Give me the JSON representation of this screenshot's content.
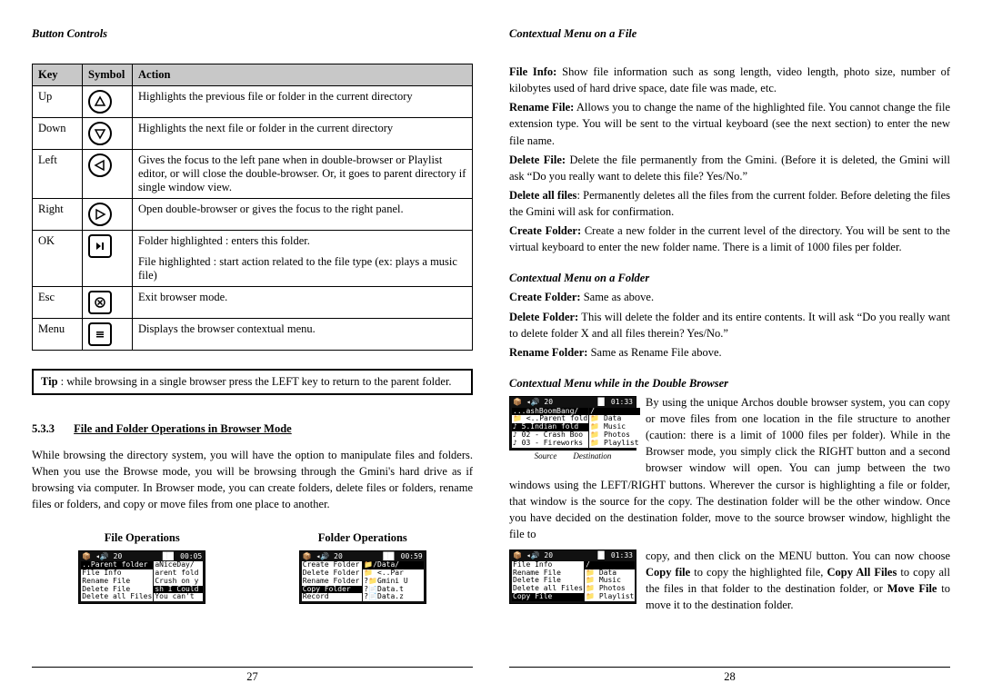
{
  "left": {
    "heading": "Button Controls",
    "table": {
      "headers": {
        "key": "Key",
        "symbol": "Symbol",
        "action": "Action"
      },
      "rows": [
        {
          "key": "Up",
          "action": "Highlights the previous file or folder in the current directory"
        },
        {
          "key": "Down",
          "action": "Highlights the next file or folder in the current directory"
        },
        {
          "key": "Left",
          "action": "Gives the focus to the left pane when in double-browser or Playlist editor, or will close the double-browser. Or, it goes to parent directory if single window view."
        },
        {
          "key": "Right",
          "action": "Open double-browser or gives the focus to the right panel."
        },
        {
          "key": "OK",
          "action": "Folder highlighted : enters this folder.",
          "action2": "File highlighted : start action related to the file type (ex: plays a music file)"
        },
        {
          "key": "Esc",
          "action": "Exit browser mode."
        },
        {
          "key": "Menu",
          "action": "Displays the browser contextual menu."
        }
      ]
    },
    "tip": "Tip : while browsing in a single browser press the LEFT key to return to the parent folder.",
    "section_num": "5.3.3",
    "section_title": "File and Folder Operations in Browser Mode",
    "body": "While browsing the directory system, you will have the option to manipulate files and folders. When you use the Browse mode, you will be browsing through the Gmini's hard drive as if browsing via computer. In Browser mode, you can create folders, delete files or folders, rename files or folders, and copy or move files from one place to another.",
    "ops": {
      "file_label": "File Operations",
      "folder_label": "Folder Operations",
      "file_screen": {
        "top_left": "📦 ◂🔊 20",
        "top_right": "██▌ 00:05",
        "left_pane": [
          "..Parent folder",
          "File Info",
          "Rename File",
          "Delete File",
          "Delete all Files"
        ],
        "right_pane": [
          "aNiceDay/",
          "arent fold",
          "Crush on y",
          "sh I Could",
          "You can't"
        ]
      },
      "folder_screen": {
        "top_left": "📦 ◂🔊 20",
        "top_right": "██▌ 00:59",
        "left_pane": [
          "Create Folder",
          "Delete Folder",
          "Rename Folder",
          "Copy Folder",
          "Record"
        ],
        "right_pane": [
          "📁/Data/",
          "📁 <..Par",
          "?📁Gmini U",
          "?📄Data.t",
          "?📄Data.z"
        ]
      }
    },
    "pagenum": "27"
  },
  "right": {
    "heading1": "Contextual Menu on a File",
    "file_defs": [
      {
        "term": "File Info:",
        "text": " Show file information such as song length, video length, photo size, number of kilobytes used of hard drive space, date file was made, etc."
      },
      {
        "term": "Rename File:",
        "text": " Allows you to change the name of the highlighted file. You cannot change the file extension type. You will be sent to the virtual keyboard (see the next section) to enter the new file name."
      },
      {
        "term": "Delete File:",
        "text": " Delete the file permanently from the Gmini. (Before it is deleted, the Gmini will ask “Do you really want to delete this file? Yes/No.”"
      },
      {
        "term": "Delete all files",
        "text": ": Permanently deletes all the files from the current folder. Before deleting the files the Gmini will ask for confirmation."
      },
      {
        "term": "Create Folder:",
        "text": " Create a new folder in the current level of the directory. You will be sent to the virtual keyboard to enter the new folder name. There is a limit of 1000 files per folder."
      }
    ],
    "heading2": "Contextual Menu on a Folder",
    "folder_defs": [
      {
        "term": "Create Folder:",
        "text": " Same as above."
      },
      {
        "term": "Delete Folder:",
        "text": " This will delete the folder and its entire contents. It will ask “Do you really want to delete folder X and all files therein? Yes/No.”"
      },
      {
        "term": "Rename Folder:",
        "text": " Same as Rename File above."
      }
    ],
    "heading3": "Contextual Menu while in the Double Browser",
    "dbl_fig1": {
      "top_left": "📦 ◂🔊 20",
      "top_right": "█▌ 01:33",
      "left_pane": [
        "...ashBoomBang/",
        "📁 <..Parent fold",
        "♪ 5.Indian fold",
        "♪ 02 - Crash Boo",
        "♪ 03 - Fireworks"
      ],
      "right_pane": [
        "/",
        "📁 Data",
        "📁 Music",
        "📁 Photos",
        "📁 Playlist"
      ],
      "caption_l": "Source",
      "caption_r": "Destination"
    },
    "dbl_fig2": {
      "top_left": "📦 ◂🔊 20",
      "top_right": "█▌ 01:33",
      "left_pane": [
        "File Info",
        "Rename File",
        "Delete File",
        "Delete all Files",
        "Copy File"
      ],
      "right_pane": [
        "/",
        "📁 Data",
        "📁 Music",
        "📁 Photos",
        "📁 Playlist"
      ]
    },
    "para1": "By using the unique Archos double browser system, you can copy or move files from one location in the file structure to another (caution: there is a limit of 1000 files per folder). While in the Browser mode, you simply click the RIGHT button and a second browser window will open. You can jump between the two windows using the LEFT/RIGHT buttons. Wherever the cursor is highlighting a file or folder, that window is the source for the copy. The destination folder will be the other window. Once you have decided on the destination folder, move to the source browser window, highlight the file to",
    "para2_pre": "copy, and then click on the MENU button. You can now choose ",
    "para2_cf": "Copy file",
    "para2_mid1": " to copy the highlighted file, ",
    "para2_caf": "Copy All Files",
    "para2_mid2": " to copy all the files in that folder to the destination folder, or ",
    "para2_mf": "Move File",
    "para2_end": " to move it to the destination folder.",
    "pagenum": "28"
  }
}
